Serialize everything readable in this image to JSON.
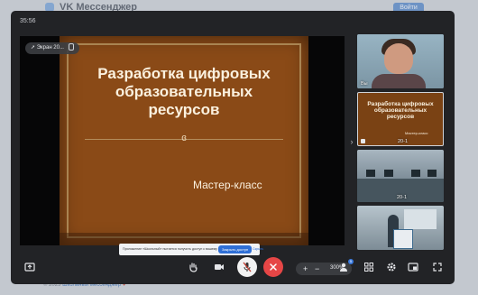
{
  "background": {
    "app_title": "VK Мессенджер",
    "top_button": "Войти",
    "footer_text": "© 2023",
    "footer_link": "Школьный мессенджер",
    "footer_heart": "♥"
  },
  "call": {
    "timer": "35:56",
    "screen_badge": "Экран 20...",
    "slide": {
      "title_line1": "Разработка цифровых",
      "title_line2": "образовательных",
      "title_line3": "ресурсов",
      "ornament": "ɞ",
      "subtitle": "Мастер-класс"
    },
    "share_notice": {
      "text": "Приложение «Школьный» пытается получить доступ к вашему экрану",
      "stop_button": "Закрыть доступ",
      "hide_link": "Скрыть"
    },
    "zoom": {
      "plus": "+",
      "minus": "−",
      "value": "300%"
    },
    "participants": [
      {
        "label": "Вы"
      },
      {
        "label": "20-1",
        "mini_title": "Разработка цифровых образовательных ресурсов",
        "mini_sub": "Мастер-класс"
      },
      {
        "label": "20-1"
      },
      {
        "label": ""
      }
    ]
  },
  "toolbar": {
    "screen_share_icon": "share-icon",
    "hand_icon": "raise-hand-icon",
    "camera_icon": "camera-icon",
    "mic_icon": "mic-off-icon",
    "end_icon": "hang-up-icon",
    "participants_badge": "5",
    "colors": {
      "end": "#e64646",
      "accent": "#3b7be0"
    }
  }
}
